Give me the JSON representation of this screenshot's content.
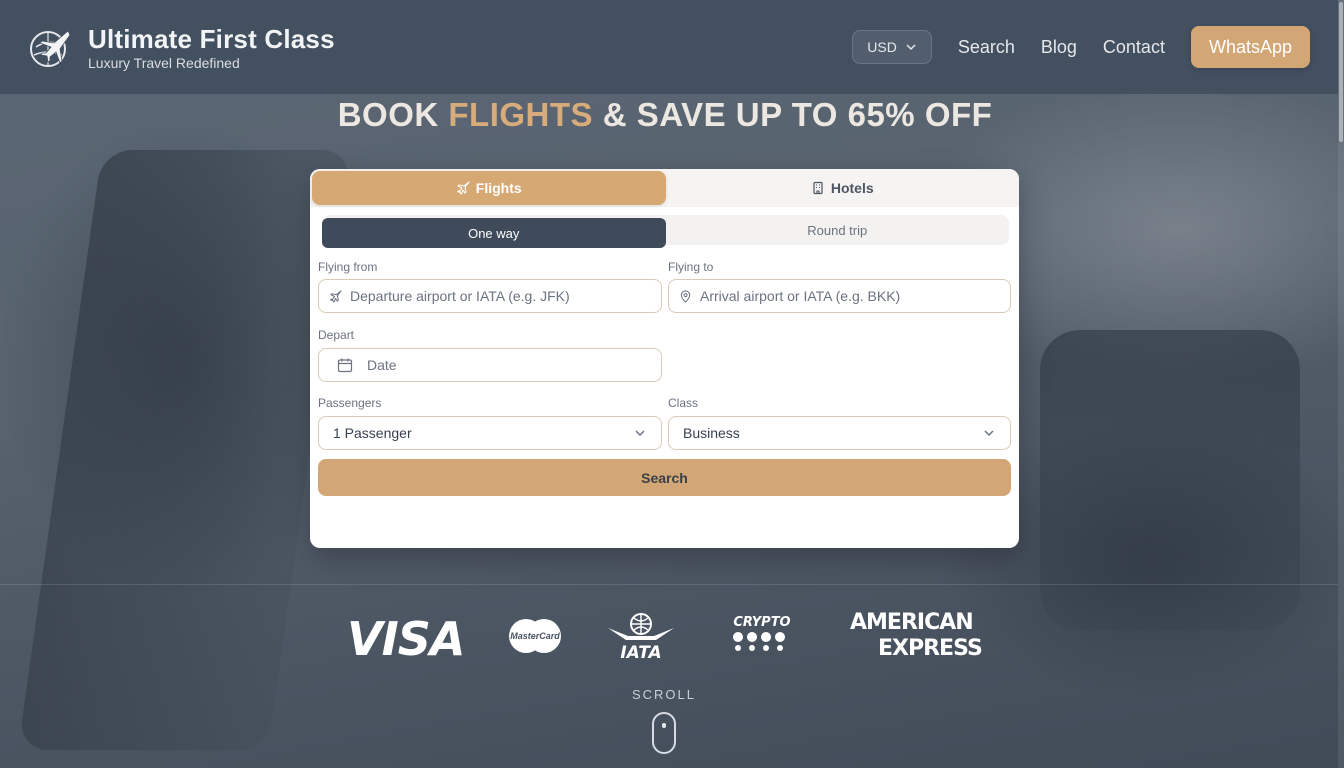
{
  "header": {
    "brand_title": "Ultimate First Class",
    "brand_tagline": "Luxury Travel Redefined",
    "currency": "USD",
    "nav": [
      "Search",
      "Blog",
      "Contact"
    ],
    "cta": "WhatsApp"
  },
  "headline": {
    "part1": "BOOK ",
    "accent": "FLIGHTS",
    "part2": " & SAVE UP TO 65% OFF"
  },
  "booking": {
    "tabs": [
      "Flights",
      "Hotels"
    ],
    "active_tab": "Flights",
    "trip_types": [
      "One way",
      "Round trip"
    ],
    "active_trip": "One way",
    "from": {
      "label": "Flying from",
      "placeholder": "Departure airport or IATA (e.g. JFK)"
    },
    "to": {
      "label": "Flying to",
      "placeholder": "Arrival airport or IATA (e.g. BKK)"
    },
    "depart": {
      "label": "Depart",
      "placeholder": "Date"
    },
    "passengers": {
      "label": "Passengers",
      "value": "1 Passenger"
    },
    "class": {
      "label": "Class",
      "value": "Business"
    },
    "search_label": "Search"
  },
  "payments": {
    "visa": "VISA",
    "mastercard": "MasterCard",
    "iata": "IATA",
    "crypto": "CRYPTO",
    "amex_line1": "AMERICAN",
    "amex_line2": "EXPRESS"
  },
  "scroll": {
    "label": "SCROLL"
  },
  "colors": {
    "accent": "#d3a676",
    "header_bg": "#435060",
    "dark_toggle": "#3f4b5a"
  }
}
